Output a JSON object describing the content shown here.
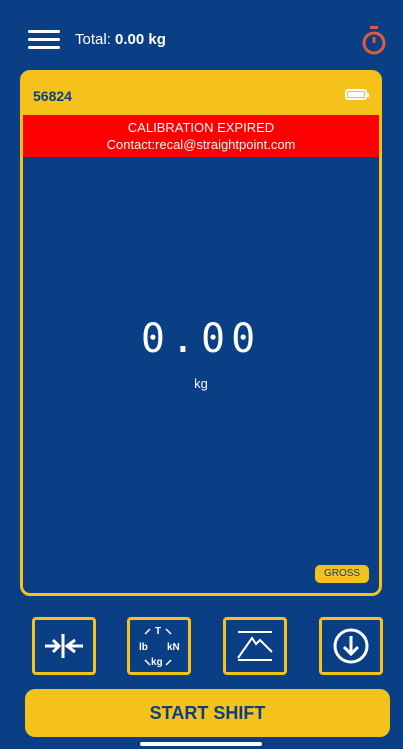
{
  "header": {
    "total_label": "Total:",
    "total_value": "0.00 kg"
  },
  "card": {
    "device_id": "56824",
    "alert_title": "CALIBRATION EXPIRED",
    "alert_contact": "Contact:recal@straightpoint.com",
    "reading": "0.00",
    "unit": "kg",
    "gross_label": "GROSS"
  },
  "tools": {
    "unit_cycle": {
      "t": "T",
      "lb": "lb",
      "kn": "kN",
      "kg": "kg"
    }
  },
  "footer": {
    "start_label": "START SHIFT"
  },
  "colors": {
    "background": "#0a3f86",
    "accent": "#f5c21b",
    "alert": "#ff0000",
    "timer": "#e15a3f"
  },
  "icons": [
    "hamburger-icon",
    "stopwatch-icon",
    "battery-icon",
    "tare-icon",
    "unit-switch-icon",
    "peak-hold-icon",
    "download-icon"
  ]
}
